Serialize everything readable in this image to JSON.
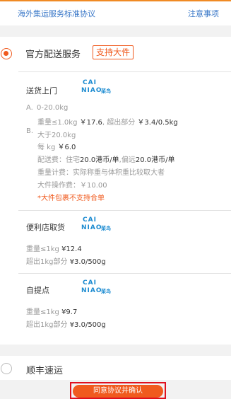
{
  "header": {
    "agreement_link": "海外集运服务标准协议",
    "notice_link": "注意事项"
  },
  "option_official": {
    "title": "官方配送服务",
    "badge": "支持大件",
    "selected": true,
    "door_delivery": {
      "title": "送货上门",
      "logo_top": "CAI",
      "logo_bottom": "NIAO",
      "logo_cn": "菜鸟",
      "a_label": "A.",
      "a_range": "0-20.0kg",
      "a_price_prefix": "重量≤1.0kg ",
      "a_price": "￥17.6",
      "a_extra_prefix": ", 超出部分 ",
      "a_extra": "￥3.4/0.5kg",
      "b_label": "B.",
      "b_range": "大于20.0kg",
      "b_perkg_prefix": "每 kg ",
      "b_perkg": "￥6.0",
      "b_fee_prefix": "配送费：住宅",
      "b_fee_home": "20.0港币/单",
      "b_fee_mid": ",偏远",
      "b_fee_remote": "20.0港币/单",
      "b_weight_rule": "重量计费：实际称重与体积重比较取大者",
      "b_handling": "大件操作费：￥10.00",
      "warning": "*大件包裹不支持合单"
    },
    "store_pickup": {
      "title": "便利店取货",
      "logo_top": "CAI",
      "logo_bottom": "NIAO",
      "logo_cn": "菜鸟",
      "line1_prefix": "重量≤1kg  ",
      "line1_value": "¥12.4",
      "line2_prefix": "超出1kg部分  ",
      "line2_value": "¥3.0/500g"
    },
    "self_pickup": {
      "title": "自提点",
      "logo_top": "CAI",
      "logo_bottom": "NIAO",
      "logo_cn": "菜鸟",
      "line1_prefix": "重量≤1kg  ",
      "line1_value": "¥9.7",
      "line2_prefix": "超出1kg部分  ",
      "line2_value": "¥3.0/500g"
    }
  },
  "option_sf": {
    "title": "顺丰速运",
    "selected": false
  },
  "footer": {
    "confirm_label": "同意协议并确认"
  },
  "colors": {
    "accent": "#f05a1e",
    "link": "#3a78c8",
    "highlight_box": "#e0101e",
    "logo": "#1a8ad0"
  }
}
